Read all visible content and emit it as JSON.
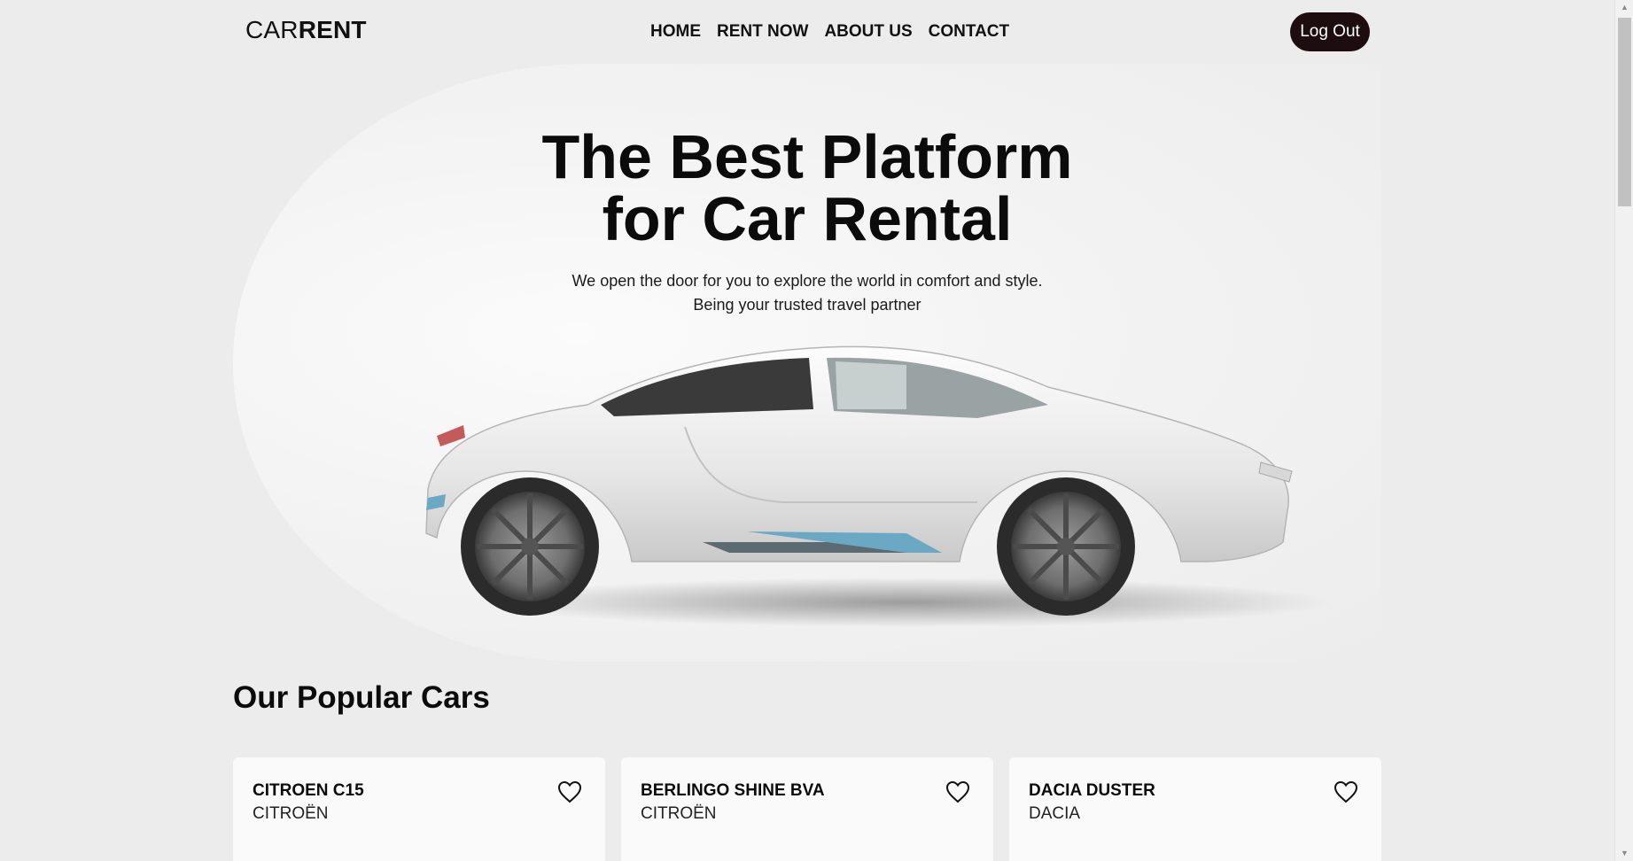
{
  "header": {
    "logo_light": "CAR",
    "logo_bold": "RENT",
    "nav": [
      "HOME",
      "RENT NOW",
      "ABOUT US",
      "CONTACT"
    ],
    "logout_label": "Log Out"
  },
  "hero": {
    "title_line1": "The Best Platform",
    "title_line2": "for Car Rental",
    "subtitle_line1": "We open the door for you to explore the world in comfort and style.",
    "subtitle_line2": "Being your trusted travel partner"
  },
  "popular": {
    "title": "Our Popular Cars",
    "cars": [
      {
        "name": "CITROEN C15",
        "brand": "CITROËN",
        "icon": "heart-outline"
      },
      {
        "name": "BERLINGO SHINE BVA",
        "brand": "CITROËN",
        "icon": "heart-outline"
      },
      {
        "name": "DACIA DUSTER",
        "brand": "DACIA",
        "icon": "heart-outline"
      }
    ]
  },
  "colors": {
    "background": "#ececec",
    "logout_bg": "#1e0d0f",
    "card_bg": "#fafafa",
    "accent_blue": "#6aa8c4"
  }
}
